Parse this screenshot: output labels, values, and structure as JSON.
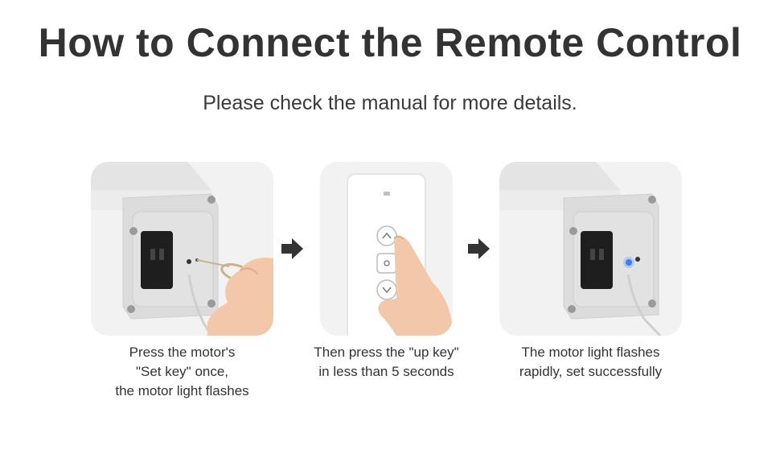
{
  "title": "How to Connect the Remote Control",
  "subtitle": "Please check the manual for more details.",
  "steps": [
    {
      "lines": [
        "Press the motor's",
        "\"Set key\" once,",
        "the motor light flashes"
      ]
    },
    {
      "lines": [
        "Then press the \"up key\"",
        "in less than 5 seconds"
      ]
    },
    {
      "lines": [
        "The motor light flashes",
        "rapidly, set successfully"
      ]
    }
  ],
  "icons": {
    "arrow": "arrow-right-icon"
  },
  "colors": {
    "text": "#333333",
    "panel": "#f1f1f1",
    "led": "#3b7bff"
  }
}
